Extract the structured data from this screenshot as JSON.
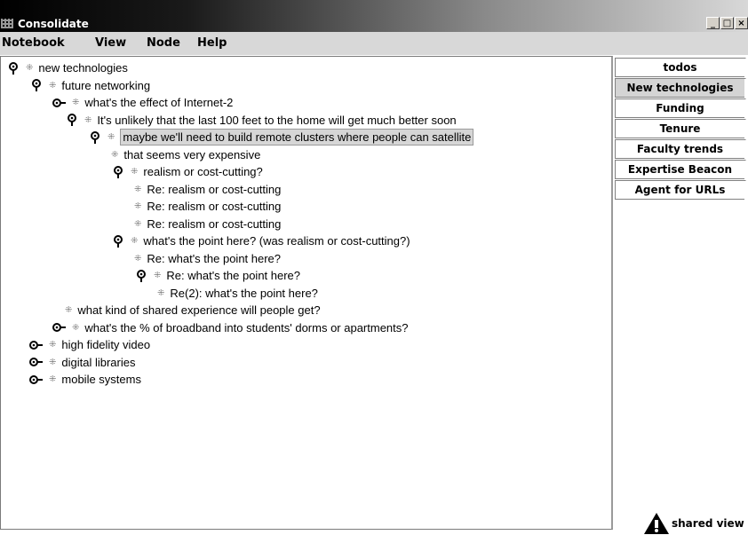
{
  "window": {
    "title": "Consolidate",
    "buttons": {
      "minimize": "_",
      "maximize": "□",
      "close": "×"
    }
  },
  "menu": {
    "items": [
      "Notebook",
      "View",
      "Node",
      "Help"
    ]
  },
  "tree": {
    "rows": [
      {
        "label": "new technologies",
        "icon": "expanded-node-icon",
        "depth": 0
      },
      {
        "label": "future networking",
        "icon": "expanded-node-icon",
        "depth": 1
      },
      {
        "label": "what's the effect of Internet-2",
        "icon": "collapsed-node-icon",
        "depth": 2
      },
      {
        "label": "It's unlikely that the last 100 feet to the home will get much better soon",
        "icon": "expanded-node-icon",
        "depth": 2
      },
      {
        "label": "maybe we'll need to build remote clusters where people can satellite",
        "icon": "expanded-node-icon",
        "depth": 3,
        "selected": true
      },
      {
        "label": "that seems very expensive",
        "icon": "leaf",
        "depth": 4
      },
      {
        "label": "realism or cost-cutting?",
        "icon": "expanded-node-icon",
        "depth": 4
      },
      {
        "label": "Re: realism or cost-cutting",
        "icon": "leaf",
        "depth": 5
      },
      {
        "label": "Re: realism or cost-cutting",
        "icon": "leaf",
        "depth": 5
      },
      {
        "label": "Re: realism or cost-cutting",
        "icon": "leaf",
        "depth": 5
      },
      {
        "label": "what's the point here?  (was realism or cost-cutting?)",
        "icon": "expanded-node-icon",
        "depth": 4
      },
      {
        "label": "Re: what's the point here?",
        "icon": "leaf",
        "depth": 5
      },
      {
        "label": "Re: what's the point here?",
        "icon": "expanded-node-icon",
        "depth": 5
      },
      {
        "label": "Re(2): what's the point here?",
        "icon": "leaf",
        "depth": 6
      },
      {
        "label": "what kind of shared experience will people get?",
        "icon": "leaf",
        "depth": 3
      },
      {
        "label": "what's the % of broadband into students' dorms or apartments?",
        "icon": "collapsed-node-icon",
        "depth": 2
      },
      {
        "label": "high fidelity video",
        "icon": "collapsed-node-icon",
        "depth": 1
      },
      {
        "label": "digital libraries",
        "icon": "collapsed-node-icon",
        "depth": 1
      },
      {
        "label": "mobile systems",
        "icon": "collapsed-node-icon",
        "depth": 1
      }
    ]
  },
  "tabs": [
    {
      "label": "todos",
      "selected": false
    },
    {
      "label": "New technologies",
      "selected": true
    },
    {
      "label": "Funding",
      "selected": false
    },
    {
      "label": "Tenure",
      "selected": false
    },
    {
      "label": "Faculty trends",
      "selected": false
    },
    {
      "label": "Expertise Beacon",
      "selected": false
    },
    {
      "label": "Agent for URLs",
      "selected": false
    }
  ],
  "shared_view": {
    "label": "shared view",
    "icon": "warning-person-icon"
  }
}
